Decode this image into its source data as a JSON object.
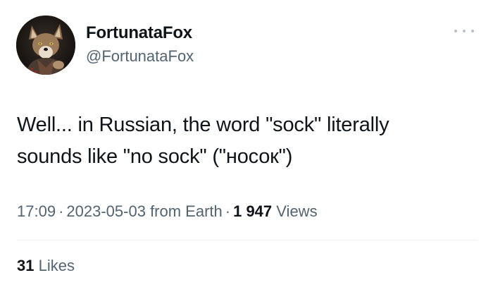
{
  "author": {
    "display_name": "FortunataFox",
    "handle": "@FortunataFox",
    "avatar": "fox-avatar-icon"
  },
  "tweet": {
    "lines": [
      "Well... in Russian, the word \"sock\" literally",
      "sounds like \"no sock\" (\"носок\")"
    ]
  },
  "meta": {
    "time": "17:09",
    "separator": "·",
    "date": "2023-05-03",
    "source": "from Earth",
    "views_count": "1 947",
    "views_label": "Views"
  },
  "stats": {
    "likes_count": "31",
    "likes_label": "Likes"
  },
  "icons": {
    "more": "more-options-icon"
  },
  "colors": {
    "text_primary": "#0f1419",
    "text_secondary": "#536471",
    "divider": "#eff3f4"
  }
}
